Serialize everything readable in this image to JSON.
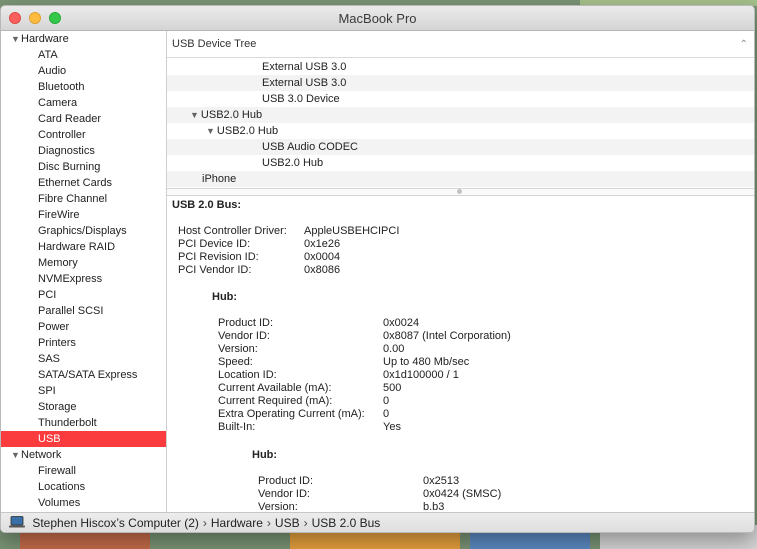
{
  "window": {
    "title": "MacBook Pro"
  },
  "sidebar": {
    "groups": [
      {
        "label": "Hardware",
        "items": [
          "ATA",
          "Audio",
          "Bluetooth",
          "Camera",
          "Card Reader",
          "Controller",
          "Diagnostics",
          "Disc Burning",
          "Ethernet Cards",
          "Fibre Channel",
          "FireWire",
          "Graphics/Displays",
          "Hardware RAID",
          "Memory",
          "NVMExpress",
          "PCI",
          "Parallel SCSI",
          "Power",
          "Printers",
          "SAS",
          "SATA/SATA Express",
          "SPI",
          "Storage",
          "Thunderbolt",
          "USB"
        ]
      },
      {
        "label": "Network",
        "items": [
          "Firewall",
          "Locations",
          "Volumes"
        ]
      }
    ],
    "selected": "USB"
  },
  "tree": {
    "header": "USB Device Tree",
    "rows": [
      {
        "label": "External USB 3.0",
        "level": 3,
        "expanded": false
      },
      {
        "label": "External USB 3.0",
        "level": 3,
        "expanded": false
      },
      {
        "label": "USB 3.0 Device",
        "level": 3,
        "expanded": false
      },
      {
        "label": "USB2.0 Hub",
        "level": 1,
        "expanded": true
      },
      {
        "label": "USB2.0 Hub",
        "level": 2,
        "expanded": true
      },
      {
        "label": "USB Audio CODEC",
        "level": 3,
        "expanded": false
      },
      {
        "label": "USB2.0 Hub",
        "level": 3,
        "expanded": false
      },
      {
        "label": "iPhone",
        "level": 1,
        "expanded": false
      }
    ]
  },
  "detail": {
    "title": "USB 2.0 Bus:",
    "bus": [
      {
        "key": "Host Controller Driver:",
        "value": "AppleUSBEHCIPCI"
      },
      {
        "key": "PCI Device ID:",
        "value": "0x1e26"
      },
      {
        "key": "PCI Revision ID:",
        "value": "0x0004"
      },
      {
        "key": "PCI Vendor ID:",
        "value": "0x8086"
      }
    ],
    "hub1": {
      "title": "Hub:",
      "props": [
        {
          "key": "Product ID:",
          "value": "0x0024"
        },
        {
          "key": "Vendor ID:",
          "value": "0x8087  (Intel Corporation)"
        },
        {
          "key": "Version:",
          "value": "0.00"
        },
        {
          "key": "Speed:",
          "value": "Up to 480 Mb/sec"
        },
        {
          "key": "Location ID:",
          "value": "0x1d100000 / 1"
        },
        {
          "key": "Current Available (mA):",
          "value": "500"
        },
        {
          "key": "Current Required (mA):",
          "value": "0"
        },
        {
          "key": "Extra Operating Current (mA):",
          "value": "0"
        },
        {
          "key": "Built-In:",
          "value": "Yes"
        }
      ]
    },
    "hub2": {
      "title": "Hub:",
      "props": [
        {
          "key": "Product ID:",
          "value": "0x2513"
        },
        {
          "key": "Vendor ID:",
          "value": "0x0424  (SMSC)"
        },
        {
          "key": "Version:",
          "value": "b.b3"
        }
      ]
    }
  },
  "statusbar": {
    "icon": "computer-icon",
    "crumbs": [
      "Stephen Hiscox’s Computer (2)",
      "Hardware",
      "USB",
      "USB 2.0 Bus"
    ],
    "separator": "›"
  },
  "colors": {
    "selection": "#fb3c3f",
    "close": "#fc605c",
    "minimize": "#fdbc40",
    "zoom": "#34c84a"
  }
}
